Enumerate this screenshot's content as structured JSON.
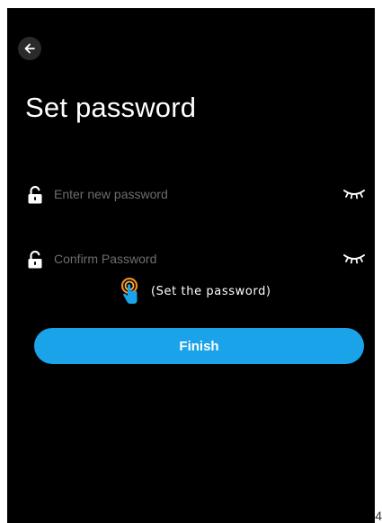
{
  "header": {
    "back_icon": "arrow-left-icon",
    "title": "Set password"
  },
  "form": {
    "new_password": {
      "placeholder": "Enter new password",
      "value": "",
      "lock_icon": "lock-open-icon",
      "visibility_icon": "eye-closed-icon"
    },
    "confirm_password": {
      "placeholder": "Confirm Password",
      "value": "",
      "lock_icon": "lock-open-icon",
      "visibility_icon": "eye-closed-icon"
    },
    "hint": {
      "icon": "tap-hand-icon",
      "text": "(Set the password)"
    },
    "finish_label": "Finish"
  },
  "page_number": "4",
  "colors": {
    "background": "#000000",
    "accent": "#1aa3e8",
    "placeholder": "#6d6d6d",
    "hint_icon_ring": "#f28c1e"
  }
}
